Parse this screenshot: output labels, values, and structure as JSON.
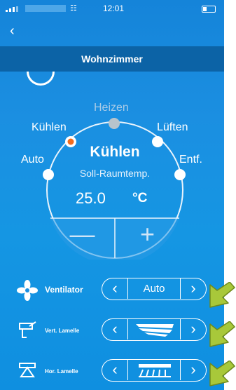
{
  "status_bar": {
    "time": "12:01"
  },
  "header": {
    "title": "Wohnzimmer"
  },
  "modes": {
    "heizen": "Heizen",
    "kuehlen": "Kühlen",
    "lueften": "Lüften",
    "auto": "Auto",
    "entf": "Entf."
  },
  "dial": {
    "current_mode": "Kühlen",
    "target_label": "Soll-Raumtemp.",
    "temperature": "25.0",
    "unit": "°C",
    "minus": "—",
    "plus": "+"
  },
  "controls": {
    "ventilator": {
      "label": "Ventilator",
      "value": "Auto"
    },
    "vert_lamelle": {
      "label": "Vert. Lamelle"
    },
    "hor_lamelle": {
      "label": "Hor. Lamelle"
    },
    "prev": "‹",
    "next": "›"
  },
  "colors": {
    "accent_orange": "#f26b1d",
    "header_bg": "#0c63a6",
    "annotation_green": "#a8c83a"
  }
}
